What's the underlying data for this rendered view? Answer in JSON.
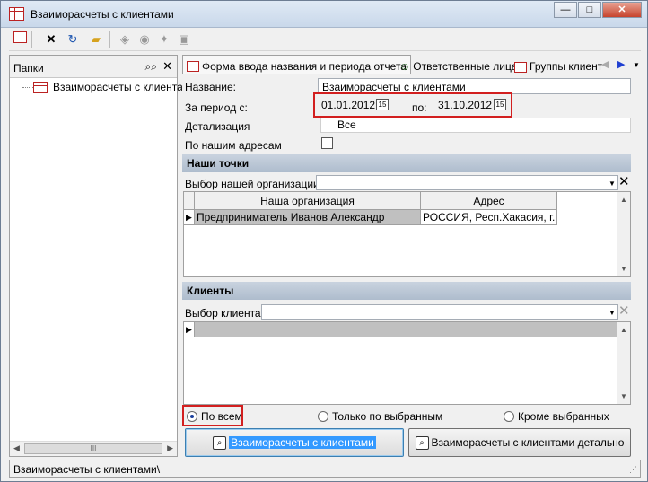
{
  "window": {
    "title": "Взаиморасчеты с клиентами",
    "minimize": "—",
    "maximize": "□",
    "close": "✕"
  },
  "toolbar": {
    "icons": [
      "grid-report-icon",
      "delete-icon",
      "refresh-icon",
      "open-folder-icon",
      "eraser-icon",
      "stamp-icon",
      "wand-icon",
      "copy-icon"
    ]
  },
  "left_panel": {
    "header_label": "Папки",
    "tree_items": [
      {
        "label": "Взаиморасчеты с клиентами"
      }
    ],
    "scroll_thumb": "III"
  },
  "tabs": [
    {
      "label": "Форма ввода названия и периода отчета",
      "active": true
    },
    {
      "label": "Ответственные лица",
      "active": false
    },
    {
      "label": "Группы клиент",
      "active": false
    }
  ],
  "form": {
    "name_label": "Название:",
    "name_value": "Взаиморасчеты с клиентами",
    "period_label": "За период с:",
    "date_from": "01.01.2012",
    "to_label": "по:",
    "date_to": "31.10.2012",
    "calendar_icon_text": "15",
    "detail_label": "Детализация",
    "detail_value": "Все",
    "our_addresses_label": "По нашим адресам",
    "our_addresses_checked": false
  },
  "our_points": {
    "section_title": "Наши точки",
    "select_label": "Выбор нашей организации:",
    "columns": [
      "Наша организация",
      "Адрес"
    ],
    "rows": [
      {
        "org": "Предприниматель Иванов Александр",
        "address": "РОССИЯ, Респ.Хакасия, г.Са"
      }
    ]
  },
  "clients": {
    "section_title": "Клиенты",
    "select_label": "Выбор клиента:"
  },
  "radio": {
    "options": [
      {
        "label": "По всем",
        "checked": true
      },
      {
        "label": "Только по выбранным",
        "checked": false
      },
      {
        "label": "Кроме выбранных",
        "checked": false
      }
    ]
  },
  "buttons": {
    "report": "Взаиморасчеты с клиентами",
    "report_detail": "Взаиморасчеты с клиентами детально"
  },
  "status": {
    "text": "Взаиморасчеты с клиентами\\"
  },
  "colors": {
    "highlight_red": "#d21f1f",
    "section_blue": "#aebccd",
    "selection_blue": "#3399ff"
  }
}
